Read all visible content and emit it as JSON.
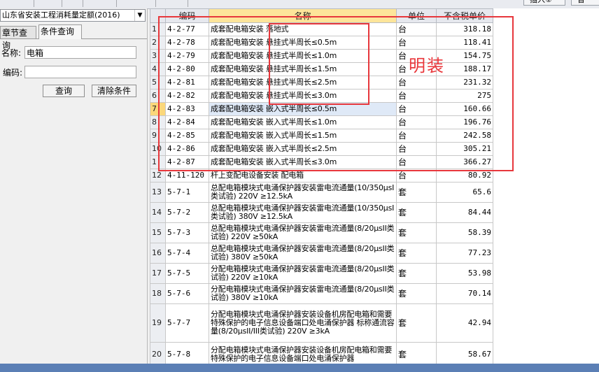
{
  "toolbar": {
    "insert_label": "插入",
    "insert_shortcut": "①",
    "next_label": "替"
  },
  "left_panel": {
    "quota_library": "山东省安装工程消耗量定额(2016)",
    "tabs": [
      {
        "label": "章节查询",
        "active": false
      },
      {
        "label": "条件查询",
        "active": true
      }
    ],
    "name_label": "名称:",
    "name_value": "电箱",
    "code_label": "编码:",
    "code_value": "",
    "query_button": "查询",
    "clear_button": "清除条件"
  },
  "grid": {
    "headers": {
      "code": "编码",
      "name": "名称",
      "unit": "单位",
      "price": "不含税单价"
    },
    "rows": [
      {
        "no": "1",
        "code": "4-2-77",
        "name": "成套配电箱安装 落地式",
        "unit": "台",
        "price": "318.18"
      },
      {
        "no": "2",
        "code": "4-2-78",
        "name": "成套配电箱安装 悬挂式半周长≤0.5m",
        "unit": "台",
        "price": "118.41"
      },
      {
        "no": "3",
        "code": "4-2-79",
        "name": "成套配电箱安装 悬挂式半周长≤1.0m",
        "unit": "台",
        "price": "154.75"
      },
      {
        "no": "4",
        "code": "4-2-80",
        "name": "成套配电箱安装 悬挂式半周长≤1.5m",
        "unit": "台",
        "price": "188.17"
      },
      {
        "no": "5",
        "code": "4-2-81",
        "name": "成套配电箱安装 悬挂式半周长≤2.5m",
        "unit": "台",
        "price": "231.32"
      },
      {
        "no": "6",
        "code": "4-2-82",
        "name": "成套配电箱安装 悬挂式半周长≤3.0m",
        "unit": "台",
        "price": "275"
      },
      {
        "no": "7",
        "code": "4-2-83",
        "name": "成套配电箱安装 嵌入式半周长≤0.5m",
        "unit": "台",
        "price": "160.66"
      },
      {
        "no": "8",
        "code": "4-2-84",
        "name": "成套配电箱安装 嵌入式半周长≤1.0m",
        "unit": "台",
        "price": "196.76"
      },
      {
        "no": "9",
        "code": "4-2-85",
        "name": "成套配电箱安装 嵌入式半周长≤1.5m",
        "unit": "台",
        "price": "242.58"
      },
      {
        "no": "10",
        "code": "4-2-86",
        "name": "成套配电箱安装 嵌入式半周长≤2.5m",
        "unit": "台",
        "price": "305.21"
      },
      {
        "no": "1",
        "code": "4-2-87",
        "name": "成套配电箱安装 嵌入式半周长≤3.0m",
        "unit": "台",
        "price": "366.27"
      },
      {
        "no": "12",
        "code": "4-11-120",
        "name": "杆上变配电设备安装 配电箱",
        "unit": "台",
        "price": "80.92"
      },
      {
        "no": "13",
        "code": "5-7-1",
        "name": "总配电箱模块式电涌保护器安装雷电流通量(10/350μsI类试验) 220V ≥12.5kA",
        "unit": "套",
        "price": "65.6"
      },
      {
        "no": "14",
        "code": "5-7-2",
        "name": "总配电箱模块式电涌保护器安装雷电流通量(10/350μsI类试验) 380V ≥12.5kA",
        "unit": "套",
        "price": "84.44"
      },
      {
        "no": "15",
        "code": "5-7-3",
        "name": "总配电箱模块式电涌保护器安装雷电流通量(8/20μsII类试验) 220V ≥50kA",
        "unit": "套",
        "price": "58.39"
      },
      {
        "no": "16",
        "code": "5-7-4",
        "name": "总配电箱模块式电涌保护器安装雷电流通量(8/20μsII类试验) 380V ≥50kA",
        "unit": "套",
        "price": "77.23"
      },
      {
        "no": "17",
        "code": "5-7-5",
        "name": "分配电箱模块式电涌保护器安装雷电流通量(8/20μsII类试验) 220V ≥10kA",
        "unit": "套",
        "price": "53.98"
      },
      {
        "no": "18",
        "code": "5-7-6",
        "name": "分配电箱模块式电涌保护器安装雷电流通量(8/20μsII类试验) 380V ≥10kA",
        "unit": "套",
        "price": "70.14"
      },
      {
        "no": "19",
        "code": "5-7-7",
        "name": "分配电箱模块式电涌保护器安装设备机房配电箱和需要特殊保护的电子信息设备端口处电涌保护器 标称通流容量(8/20μsII/III类试验) 220V ≥3kA",
        "unit": "套",
        "price": "42.94"
      },
      {
        "no": "20",
        "code": "5-7-8",
        "name": "分配电箱模块式电涌保护器安装设备机房配电箱和需要特殊保护的电子信息设备端口处电涌保护器",
        "unit": "套",
        "price": "58.67"
      }
    ],
    "selected_row": 7
  },
  "annotation": {
    "text": "明装",
    "color": "#e7373c"
  }
}
